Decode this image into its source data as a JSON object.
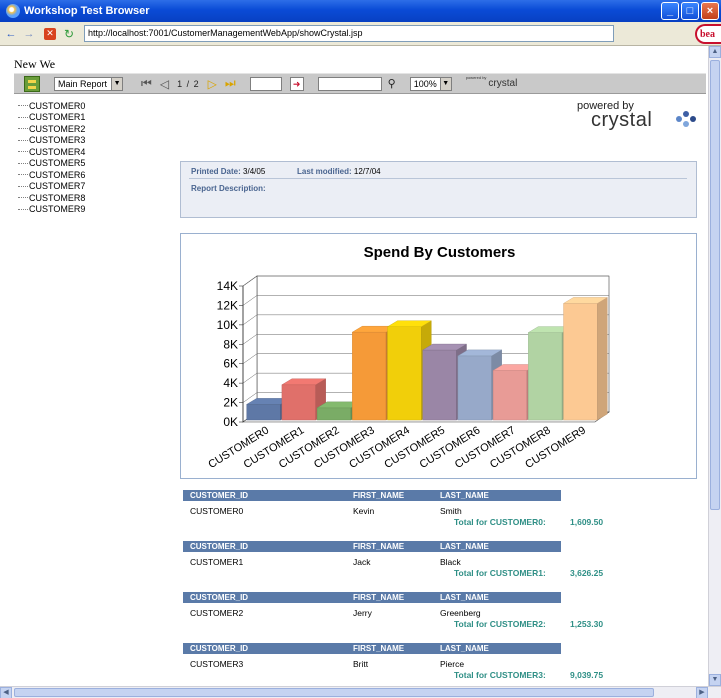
{
  "window": {
    "title": "Workshop Test Browser",
    "buttons": {
      "minimize": "_",
      "maximize": "□",
      "close": "×"
    }
  },
  "nav": {
    "back": "←",
    "forward": "→",
    "stop": "✕",
    "refresh": "↻",
    "address": "http://localhost:7001/CustomerManagementWebApp/showCrystal.jsp",
    "logo": "bea"
  },
  "page": {
    "heading": "New We"
  },
  "toolbar": {
    "report_select": "Main Report",
    "first": "⏮",
    "prev": "◁",
    "page_indicator": "1 / 2",
    "next": "▷",
    "last": "⏭",
    "goto": "➜",
    "search": "⚲",
    "zoom": "100%",
    "powered_small": "powered by",
    "powered_word": "crystal"
  },
  "tree": {
    "items": [
      "CUSTOMER0",
      "CUSTOMER1",
      "CUSTOMER2",
      "CUSTOMER3",
      "CUSTOMER4",
      "CUSTOMER5",
      "CUSTOMER6",
      "CUSTOMER7",
      "CUSTOMER8",
      "CUSTOMER9"
    ]
  },
  "crystal_logo": {
    "powered": "powered by",
    "word": "crystal"
  },
  "info": {
    "printed_label": "Printed Date:",
    "printed_value": "3/4/05",
    "modified_label": "Last modified:",
    "modified_value": "12/7/04",
    "description_label": "Report Description:"
  },
  "chart_data": {
    "type": "bar",
    "title": "Spend By Customers",
    "categories": [
      "CUSTOMER0",
      "CUSTOMER1",
      "CUSTOMER2",
      "CUSTOMER3",
      "CUSTOMER4",
      "CUSTOMER5",
      "CUSTOMER6",
      "CUSTOMER7",
      "CUSTOMER8",
      "CUSTOMER9"
    ],
    "values": [
      1609.5,
      3626.25,
      1253.3,
      9039.75,
      9600,
      7200,
      6600,
      5100,
      9000,
      12000
    ],
    "colors": [
      "#5e78a6",
      "#e0706a",
      "#7aac66",
      "#f59a38",
      "#f1cf0a",
      "#9a86a6",
      "#97a9c9",
      "#e89b96",
      "#b1d3a3",
      "#fcc993"
    ],
    "ylim": [
      0,
      14000
    ],
    "ytick_labels": [
      "0K",
      "2K",
      "4K",
      "6K",
      "8K",
      "10K",
      "12K",
      "14K"
    ],
    "ytick_values": [
      0,
      2000,
      4000,
      6000,
      8000,
      10000,
      12000,
      14000
    ],
    "grid": true,
    "style": "3d"
  },
  "table": {
    "headers": {
      "id": "CUSTOMER_ID",
      "first": "FIRST_NAME",
      "last": "LAST_NAME"
    },
    "groups": [
      {
        "id": "CUSTOMER0",
        "first": "Kevin",
        "last": "Smith",
        "total_label": "Total for CUSTOMER0:",
        "total": "1,609.50"
      },
      {
        "id": "CUSTOMER1",
        "first": "Jack",
        "last": "Black",
        "total_label": "Total for CUSTOMER1:",
        "total": "3,626.25"
      },
      {
        "id": "CUSTOMER2",
        "first": "Jerry",
        "last": "Greenberg",
        "total_label": "Total for CUSTOMER2:",
        "total": "1,253.30"
      },
      {
        "id": "CUSTOMER3",
        "first": "Britt",
        "last": "Pierce",
        "total_label": "Total for CUSTOMER3:",
        "total": "9,039.75"
      }
    ]
  },
  "scroll": {
    "up": "▲",
    "down": "▼",
    "left": "◀",
    "right": "▶"
  }
}
